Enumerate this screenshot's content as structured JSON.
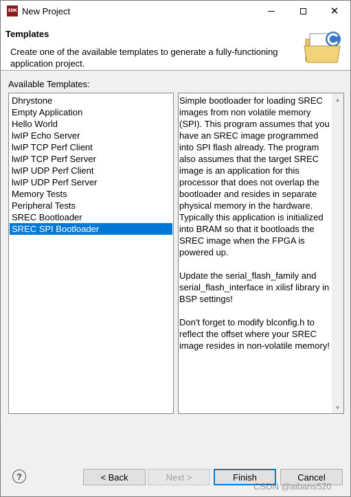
{
  "window": {
    "app_icon_text": "SDK",
    "title": "New Project"
  },
  "banner": {
    "title": "Templates",
    "description": "Create one of the available templates to generate a fully-functioning application project."
  },
  "templates": {
    "label": "Available Templates:",
    "items": [
      "Dhrystone",
      "Empty Application",
      "Hello World",
      "lwIP Echo Server",
      "lwIP TCP Perf Client",
      "lwIP TCP Perf Server",
      "lwIP UDP Perf Client",
      "lwIP UDP Perf Server",
      "Memory Tests",
      "Peripheral Tests",
      "SREC Bootloader",
      "SREC SPI Bootloader"
    ],
    "selected": "SREC SPI Bootloader"
  },
  "description": {
    "text": "Simple bootloader for loading SREC images from non volatile memory (SPI). This program assumes that you have an SREC image programmed into SPI flash already. The program also assumes that the target SREC image is an application for this processor that does not overlap the bootloader and resides in separate physical memory in the hardware. Typically this application is initialized into BRAM so that it bootloads the SREC image when the FPGA is powered up.\n\nUpdate the serial_flash_family and serial_flash_interface in xilisf library in BSP settings!\n\nDon't forget to modify blconfig.h to reflect the offset where your SREC image resides in non-volatile memory!"
  },
  "buttons": {
    "help": "?",
    "back": "< Back",
    "next": "Next >",
    "finish": "Finish",
    "cancel": "Cancel"
  },
  "watermark": "CSDN @aibans520",
  "colors": {
    "selection": "#0078d7",
    "app_icon": "#8b1a1a"
  }
}
